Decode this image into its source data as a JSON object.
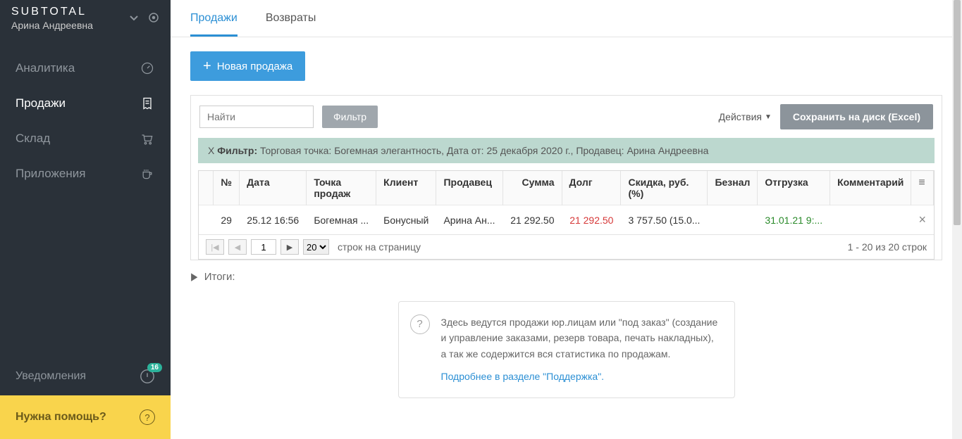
{
  "app": {
    "brand": "SUBTOTAL",
    "username": "Арина Андреевна"
  },
  "sidebar": {
    "items": [
      {
        "label": "Аналитика"
      },
      {
        "label": "Продажи"
      },
      {
        "label": "Склад"
      },
      {
        "label": "Приложения"
      }
    ],
    "notifications": {
      "label": "Уведомления",
      "badge": "16"
    },
    "help": {
      "label": "Нужна помощь?"
    }
  },
  "tabs": {
    "sales": "Продажи",
    "returns": "Возвраты"
  },
  "buttons": {
    "new_sale": "Новая продажа",
    "filter": "Фильтр",
    "actions": "Действия",
    "save_excel": "Сохранить на диск (Excel)"
  },
  "search": {
    "placeholder": "Найти"
  },
  "filter_bar": {
    "prefix": "Фильтр:",
    "text": "Торговая точка: Богемная элегантность, Дата от: 25 декабря 2020 г., Продавец: Арина Андреевна"
  },
  "table": {
    "headers": {
      "num": "№",
      "date": "Дата",
      "point": "Точка продаж",
      "client": "Клиент",
      "seller": "Продавец",
      "sum": "Сумма",
      "debt": "Долг",
      "discount": "Скидка, руб. (%)",
      "cashless": "Безнал",
      "shipment": "Отгрузка",
      "comment": "Комментарий"
    },
    "rows": [
      {
        "num": "29",
        "date": "25.12 16:56",
        "point": "Богемная ...",
        "client": "Бонусный",
        "seller": "Арина Ан...",
        "sum": "21 292.50",
        "debt": "21 292.50",
        "discount": "3 757.50 (15.0...",
        "cashless": "",
        "shipment": "31.01.21 9:...",
        "comment": ""
      }
    ]
  },
  "pager": {
    "page": "1",
    "page_size": "20",
    "per_page_label": "строк на страницу",
    "info": "1 - 20 из 20 строк"
  },
  "totals": {
    "label": "Итоги:"
  },
  "help_box": {
    "text": "Здесь ведутся продажи юр.лицам или \"под заказ\" (создание и управление заказами, резерв товара, печать накладных), а так же содержится вся статистика по продажам.",
    "link": "Подробнее в разделе \"Поддержка\"."
  }
}
